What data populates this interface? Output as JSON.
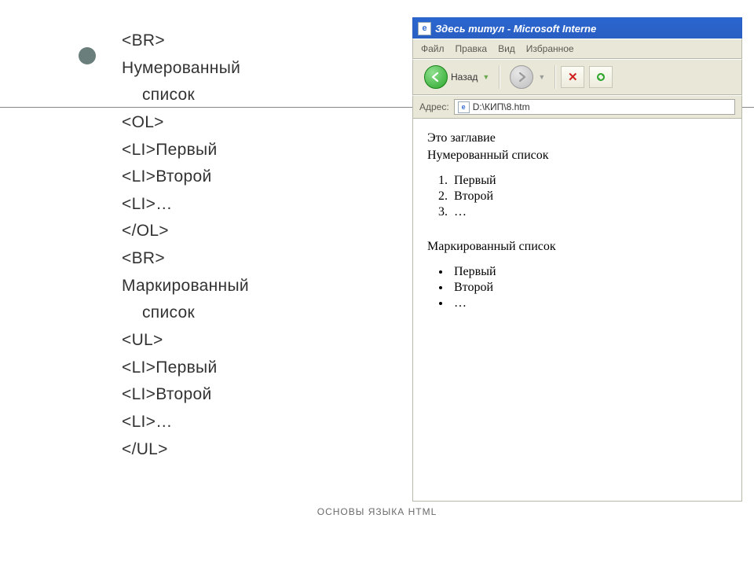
{
  "code": {
    "l1": "<BR>",
    "l2": "Нумерованный",
    "l2b": "список",
    "l3": "<OL>",
    "l4": "<LI>Первый",
    "l5": "<LI>Второй",
    "l6": "<LI>…",
    "l7": "</OL>",
    "l8": "<BR>",
    "l9": "Маркированный",
    "l9b": "список",
    "l10": "<UL>",
    "l11": "<LI>Первый",
    "l12": "<LI>Второй",
    "l13": "<LI>…",
    "l14": "</UL>"
  },
  "browser": {
    "title": "Здесь титул - Microsoft Interne",
    "menu": {
      "file": "Файл",
      "edit": "Правка",
      "view": "Вид",
      "favorites": "Избранное"
    },
    "toolbar": {
      "back_label": "Назад"
    },
    "addressbar": {
      "label": "Адрес:",
      "value": "D:\\КИП\\8.htm"
    },
    "page": {
      "heading": "Это заглавие",
      "ordered_title": "Нумерованный список",
      "ol": [
        "Первый",
        "Второй",
        "…"
      ],
      "unordered_title": "Маркированный список",
      "ul": [
        "Первый",
        "Второй",
        "…"
      ]
    }
  },
  "footer": "ОСНОВЫ ЯЗЫКА HTML"
}
